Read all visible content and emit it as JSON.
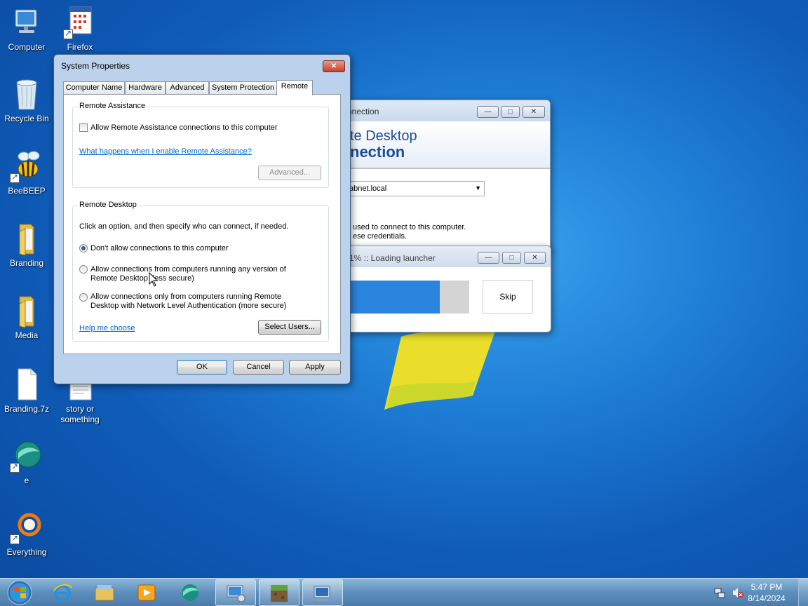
{
  "desktop": {
    "icons": [
      {
        "label": "Computer",
        "icon": "computer-icon"
      },
      {
        "label": "Firefox",
        "icon": "firefox-icon"
      },
      {
        "label": "Recycle Bin",
        "icon": "recycle-bin-icon"
      },
      {
        "label": "BeeBEEP",
        "icon": "beebeep-icon"
      },
      {
        "label": "Branding",
        "icon": "folder-icon"
      },
      {
        "label": "Media",
        "icon": "folder-icon"
      },
      {
        "label": "Branding.7z",
        "icon": "file-icon"
      },
      {
        "label": "story or\nsomething",
        "icon": "text-file-icon"
      },
      {
        "label": "e",
        "icon": "globe-icon"
      },
      {
        "label": "Everything",
        "icon": "everything-search-icon"
      }
    ]
  },
  "sysprops": {
    "title": "System Properties",
    "close": "✕",
    "tabs": [
      "Computer Name",
      "Hardware",
      "Advanced",
      "System Protection",
      "Remote"
    ],
    "active_tab": "Remote",
    "remote_assistance": {
      "group_title": "Remote Assistance",
      "checkbox_label": "Allow Remote Assistance connections to this computer",
      "checked": false,
      "help_link": "What happens when I enable Remote Assistance?",
      "advanced_button": "Advanced..."
    },
    "remote_desktop": {
      "group_title": "Remote Desktop",
      "instruction": "Click an option, and then specify who can connect, if needed.",
      "options": [
        {
          "line1": "Don't allow connections to this computer",
          "line2": "",
          "selected": true
        },
        {
          "line1": "Allow connections from computers running any version of",
          "line2": "Remote Desktop (less secure)",
          "selected": false
        },
        {
          "line1": "Allow connections only from computers running Remote",
          "line2": "Desktop with Network Level Authentication (more secure)",
          "selected": false
        }
      ],
      "help_link": "Help me choose",
      "select_users_button": "Select Users..."
    },
    "buttons": {
      "ok": "OK",
      "cancel": "Cancel",
      "apply": "Apply"
    }
  },
  "rdc": {
    "title": "nnection",
    "banner_line1": "te Desktop",
    "banner_line2": "nection",
    "computer_value": "abnet.local",
    "info_line1": "used to connect to this computer.",
    "info_line2": "ese credentials.",
    "minimize": "—",
    "maximize": "□",
    "close": "✕"
  },
  "loader": {
    "title": "1% :: Loading launcher",
    "progress_fraction": 0.78,
    "skip": "Skip",
    "minimize": "—",
    "maximize": "□",
    "close": "✕"
  },
  "taskbar": {
    "items": [
      "start-orb-icon",
      "internet-explorer-icon",
      "file-explorer-icon",
      "media-player-icon",
      "globe-icon",
      "remote-desktop-icon",
      "minecraft-icon",
      "system-properties-icon"
    ],
    "time": "5:47 PM",
    "date": "8/14/2024"
  },
  "colors": {
    "accent_blue": "#2a84de",
    "link": "#0066cc",
    "rdc_banner_text": "#1c4d9a"
  }
}
